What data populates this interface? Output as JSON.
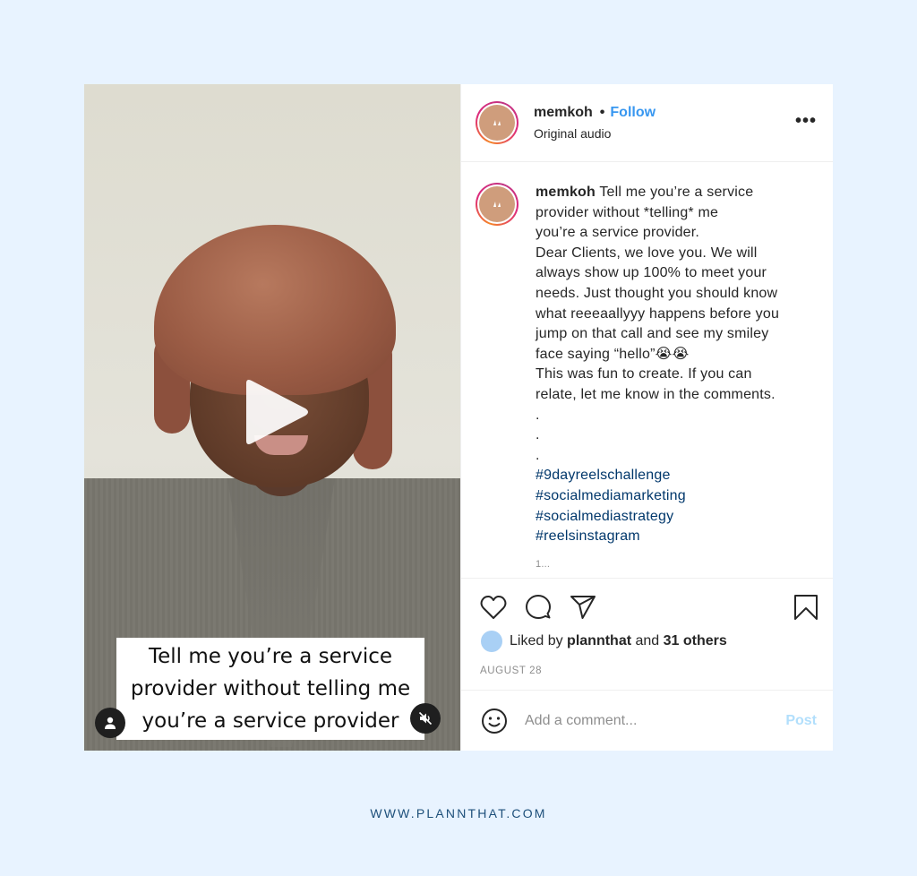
{
  "video": {
    "overlay_caption_lines": [
      "Tell me you’re a service",
      "provider without telling me",
      "you’re a service provider"
    ],
    "icons": {
      "play": "play-icon",
      "user": "user-tag-icon",
      "mute": "muted-speaker-icon"
    }
  },
  "header": {
    "username": "memkoh",
    "separator": "•",
    "follow_label": "Follow",
    "subtitle": "Original audio",
    "more_label": "•••"
  },
  "caption": {
    "username": "memkoh",
    "first_line": "Tell me you’re a service",
    "lines": [
      "provider without *telling* me",
      "you’re a service provider.",
      "Dear Clients, we love you. We will",
      "always show up 100% to meet your",
      "needs. Just thought you should know",
      "what reeeaallyyy happens before you",
      "jump on that call and see my smiley",
      "face saying “hello”😭😭",
      "This was fun to create. If you can",
      "relate, let me know in the comments.",
      ".",
      ".",
      "."
    ],
    "hashtags": [
      "#9dayreelschallenge",
      "#socialmediamarketing",
      "#socialmediastrategy",
      "#reelsinstagram"
    ],
    "truncated_hint": "1..."
  },
  "actions": {
    "icons": [
      "heart-icon",
      "comment-icon",
      "share-icon",
      "bookmark-icon"
    ]
  },
  "likes": {
    "prefix": "Liked by",
    "user": "plannthat",
    "middle": "and",
    "others": "31 others"
  },
  "date": "AUGUST 28",
  "comment": {
    "placeholder": "Add a comment...",
    "value": "",
    "post_label": "Post"
  },
  "footer": {
    "url": "WWW.PLANNTHAT.COM"
  },
  "colors": {
    "page_background": "#e8f3ff",
    "follow_blue": "#3897f0",
    "hashtag_blue": "#00376b",
    "post_disabled": "#b2dffc",
    "footer_text": "#1d4f7a"
  }
}
